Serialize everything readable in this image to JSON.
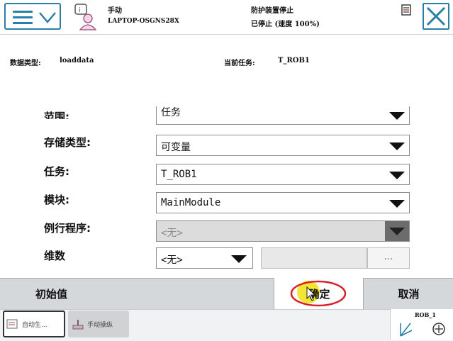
{
  "topbar": {
    "mode": "手动",
    "host": "LAPTOP-OSGNS28X",
    "safety": "防护装置停止",
    "state": "已停止 (速度 100%)"
  },
  "header": {
    "datatype_label": "数据类型:",
    "datatype_value": "loaddata",
    "task_label": "当前任务:",
    "task_value": "T_ROB1"
  },
  "form": {
    "scope": {
      "label": "范围:",
      "value": "任务"
    },
    "storage": {
      "label": "存储类型:",
      "value": "可变量"
    },
    "task": {
      "label": "任务:",
      "value": "T_ROB1"
    },
    "module": {
      "label": "模块:",
      "value": "MainModule"
    },
    "routine": {
      "label": "例行程序:",
      "value": "<无>"
    },
    "dimension": {
      "label": "维数",
      "value": "<无>",
      "more": "..."
    }
  },
  "bottom": {
    "init_value": "初始值",
    "ok": "确定",
    "cancel": "取消"
  },
  "taskbar": {
    "task1": "自动生...",
    "task2": "手动操纵",
    "rob_label": "ROB_1"
  },
  "colors": {
    "accent": "#2a7fa8",
    "highlight_ring": "#d8202a",
    "cursor_glow": "#f2e21c"
  }
}
